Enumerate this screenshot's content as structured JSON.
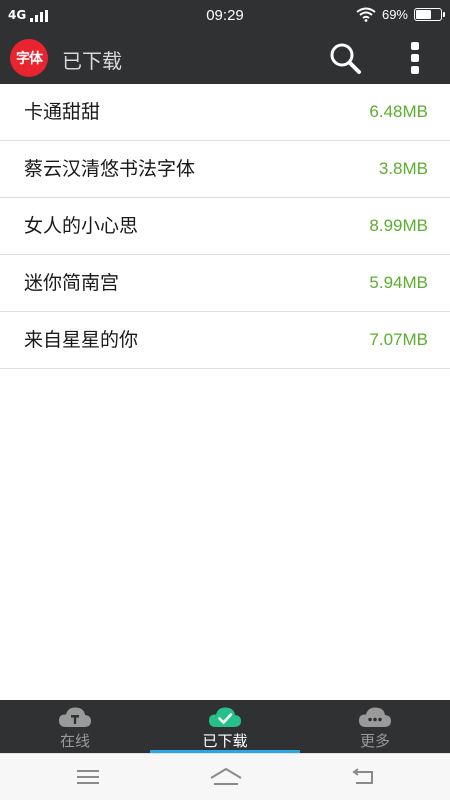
{
  "status_bar": {
    "network": "4G",
    "time": "09:29",
    "battery_text": "69%",
    "battery_level": 0.69
  },
  "app_bar": {
    "logo_text": "字体",
    "title": "已下载",
    "search_icon": "search-icon",
    "more_icon": "more-vertical-icon"
  },
  "fonts": [
    {
      "name": "卡通甜甜",
      "size": "6.48MB"
    },
    {
      "name": "蔡云汉清悠书法字体",
      "size": "3.8MB"
    },
    {
      "name": "女人的小心思",
      "size": "8.99MB"
    },
    {
      "name": "迷你简南宫",
      "size": "5.94MB"
    },
    {
      "name": "来自星星的你",
      "size": "7.07MB"
    }
  ],
  "tabs": [
    {
      "label": "在线",
      "icon": "cloud-font-icon",
      "active": false
    },
    {
      "label": "已下载",
      "icon": "cloud-check-icon",
      "active": true
    },
    {
      "label": "更多",
      "icon": "cloud-more-icon",
      "active": false
    }
  ],
  "colors": {
    "bar_bg": "#2f3133",
    "size_green": "#5cae2e",
    "active_tab_icon": "#26c08a",
    "indicator_blue": "#2aa7e0",
    "logo_red": "#e8242f"
  },
  "nav_bar": {
    "menu_icon": "menu-icon",
    "home_icon": "home-icon",
    "back_icon": "back-icon"
  }
}
